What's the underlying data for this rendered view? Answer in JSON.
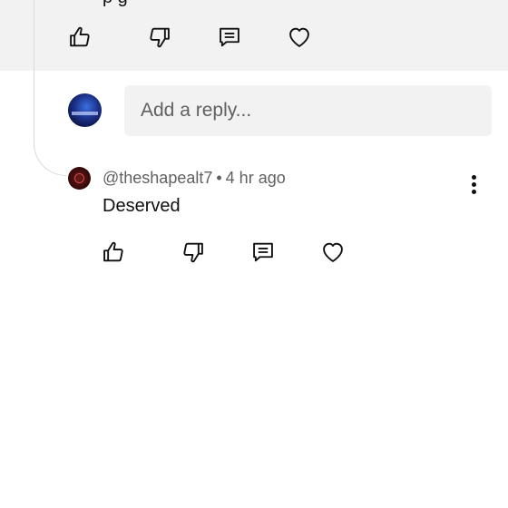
{
  "parent_comment": {
    "partial_text": "p         g"
  },
  "reply_box": {
    "placeholder": "Add a reply..."
  },
  "reply": {
    "author": "@theshapealt7",
    "separator": "•",
    "time": "4 hr ago",
    "text": "Deserved"
  },
  "icons": {
    "like": "thumbs-up-icon",
    "dislike": "thumbs-down-icon",
    "reply": "comment-icon",
    "heart": "heart-icon",
    "more": "more-vertical-icon"
  }
}
